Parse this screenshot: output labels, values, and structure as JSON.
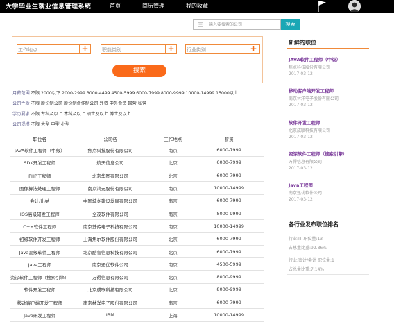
{
  "header": {
    "logo": "大学毕业生就业信息管理系统",
    "nav": [
      "首页",
      "简历管理",
      "我的收藏"
    ]
  },
  "search": {
    "placeholder": "输入要搜索的公司",
    "button": "搜索"
  },
  "filters": {
    "location": "工作地点",
    "category": "职能类别",
    "industry": "行业类别",
    "submit": "搜索"
  },
  "conditions": [
    {
      "label": "月薪范围",
      "options": "不限 2000以下 2000-2999 3000-4499 4500-5999 6000-7999 8000-9999 10000-14999 15000以上"
    },
    {
      "label": "公司性质",
      "options": "不限 股份制公司 股份制合作制公司 外资 中外合资 国营 私营"
    },
    {
      "label": "学历要求",
      "options": "不限 专科及以上 本科及以上 硕士及以上 博士及以上"
    },
    {
      "label": "公司规模",
      "options": "不限 大型 中型 小型"
    }
  ],
  "table": {
    "headers": [
      "职位名",
      "公司名",
      "工作地点",
      "薪资"
    ],
    "rows": [
      [
        "JAVA软件工程师（中级）",
        "焦点科技股份有限公司",
        "南京",
        "6000-7999"
      ],
      [
        "SDK开发工程师",
        "航天信息公司",
        "北京",
        "6000-7999"
      ],
      [
        "PHP工程师",
        "北京华图有限公司",
        "北京",
        "6000-7999"
      ],
      [
        "图像算法处理工程师",
        "南京鸿元股份有限公司",
        "南京",
        "10000-14999"
      ],
      [
        "会计/出纳",
        "中国城乡建设发展有限公司",
        "南京",
        "6000-7999"
      ],
      [
        "IOS高级研发工程师",
        "全茂软件有限公司",
        "南京",
        "8000-9999"
      ],
      [
        "C++软件工程师",
        "南京苏传电子科技有限公司",
        "南京",
        "10000-14999"
      ],
      [
        "初级软件开发工程师",
        "上海焦尔软件股份有限公司",
        "北京",
        "6000-7999"
      ],
      [
        "Java高级软件工程师",
        "北京酷睿信息科技有限公司",
        "北京",
        "6000-7999"
      ],
      [
        "Java工程师",
        "南京迅优软件公司",
        "南京",
        "4500-5999"
      ],
      [
        "资深软件工程师（搜索引擎）",
        "万得信息有限公司",
        "北京",
        "8000-9999"
      ],
      [
        "软件开发工程师",
        "北京成联科技有限公司",
        "北京",
        "8000-9999"
      ],
      [
        "移动客户端开发工程师",
        "南京林洋电子股份有限公司",
        "南京",
        "6000-7999"
      ],
      [
        "Java研发工程师",
        "IBM",
        "上海",
        "10000-14999"
      ]
    ]
  },
  "sidebar": {
    "fresh_title": "新鲜的职位",
    "jobs": [
      {
        "title": "JAVA软件工程师（中级）",
        "company": "焦点科技股份有限公司",
        "date": "2017-03-12"
      },
      {
        "title": "移动客户端开发工程师",
        "company": "南京林洋电子股份有限公司",
        "date": "2017-03-12"
      },
      {
        "title": "软件开发工程师",
        "company": "北京成联科技有限公司",
        "date": "2017-03-12"
      },
      {
        "title": "资深软件工程师（搜索引擎）",
        "company": "万得信息有限公司",
        "date": "2017-03-12"
      },
      {
        "title": "Java工程师",
        "company": "南京迅优软件公司",
        "date": "2017-03-12"
      }
    ],
    "rank_title": "各行业发布职位排名",
    "rank": [
      {
        "line1": "行业:IT     职位量:13",
        "line2": "占总量比重:92.86%"
      },
      {
        "line1": "行业:审计/会计     职位量:1",
        "line2": "占总量比重:7.14%"
      }
    ]
  },
  "colors": {
    "topbar": "#000000",
    "accent_orange": "#fa6a1a",
    "search_teal": "#1aa7b5",
    "job_title_purple": "#7a3a9a"
  },
  "icons": [
    "flag-icon",
    "user-avatar-icon",
    "search-icon",
    "plus-icon"
  ]
}
